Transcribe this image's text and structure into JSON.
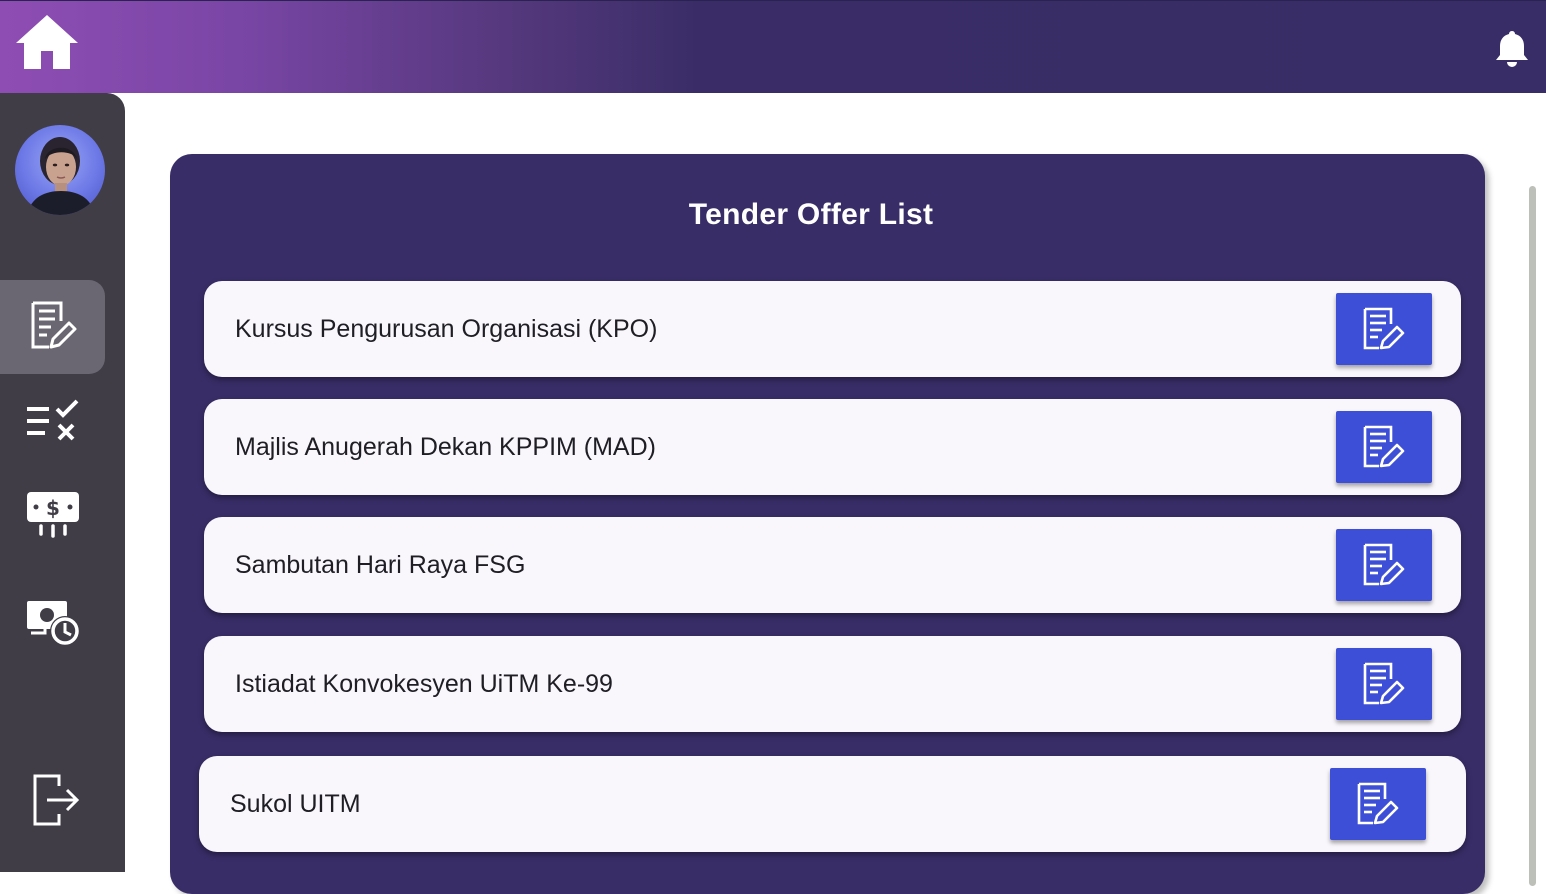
{
  "header": {
    "home_icon": "home-icon",
    "notification_icon": "bell-icon",
    "gradient_colors": [
      "#8e4db3",
      "#382d66"
    ]
  },
  "sidebar": {
    "avatar": "user-avatar",
    "items": [
      {
        "icon": "document-edit-icon",
        "active": true
      },
      {
        "icon": "checklist-icon",
        "active": false
      },
      {
        "icon": "money-icon",
        "active": false
      },
      {
        "icon": "payment-history-icon",
        "active": false
      }
    ],
    "logout_icon": "logout-icon",
    "background": "#403d47"
  },
  "main": {
    "title": "Tender Offer List",
    "panel_color": "#382d66",
    "button_color": "#3d4fd6",
    "tenders": [
      {
        "name": "Kursus Pengurusan Organisasi (KPO)"
      },
      {
        "name": "Majlis Anugerah Dekan KPPIM (MAD)"
      },
      {
        "name": "Sambutan Hari Raya FSG"
      },
      {
        "name": "Istiadat Konvokesyen UiTM Ke-99"
      },
      {
        "name": "Sukol UITM"
      }
    ]
  }
}
